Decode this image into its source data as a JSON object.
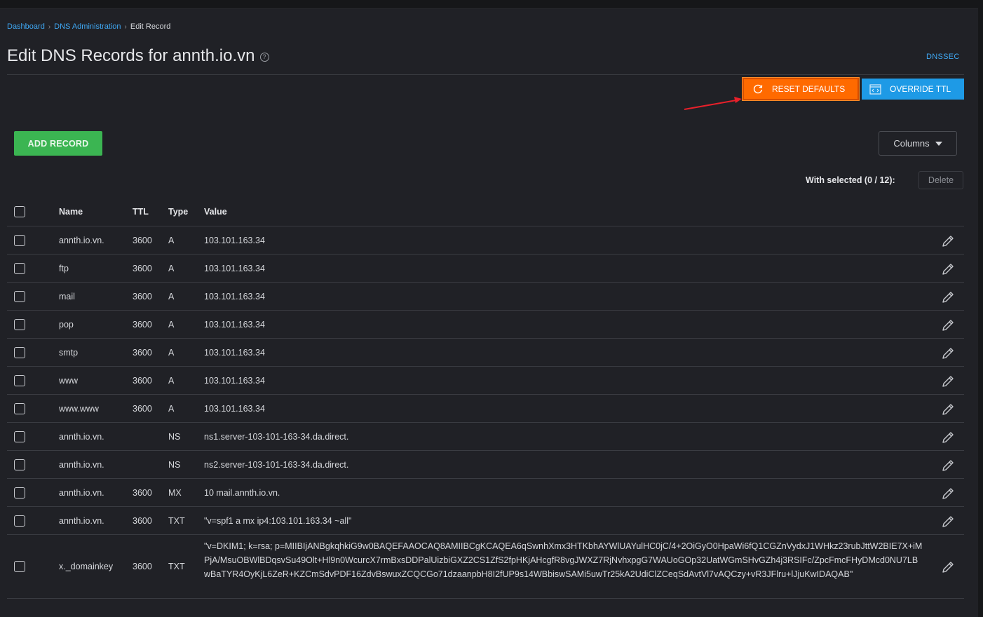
{
  "breadcrumb": {
    "items": [
      "Dashboard",
      "DNS Administration",
      "Edit Record"
    ]
  },
  "header": {
    "title": "Edit DNS Records for annth.io.vn",
    "dnssec_link": "DNSSEC"
  },
  "toolbar": {
    "reset_label": "RESET DEFAULTS",
    "override_label": "OVERRIDE TTL",
    "add_label": "ADD RECORD",
    "columns_label": "Columns",
    "with_selected_label": "With selected (0 / 12):",
    "delete_label": "Delete"
  },
  "colors": {
    "reset": "#ff6a00",
    "override": "#1e9ae6",
    "add": "#3bb552",
    "link": "#3fa9f5",
    "annotation_arrow": "#e8202a"
  },
  "table": {
    "headers": {
      "name": "Name",
      "ttl": "TTL",
      "type": "Type",
      "value": "Value"
    },
    "rows": [
      {
        "name": "annth.io.vn.",
        "ttl": "3600",
        "type": "A",
        "value": "103.101.163.34"
      },
      {
        "name": "ftp",
        "ttl": "3600",
        "type": "A",
        "value": "103.101.163.34"
      },
      {
        "name": "mail",
        "ttl": "3600",
        "type": "A",
        "value": "103.101.163.34"
      },
      {
        "name": "pop",
        "ttl": "3600",
        "type": "A",
        "value": "103.101.163.34"
      },
      {
        "name": "smtp",
        "ttl": "3600",
        "type": "A",
        "value": "103.101.163.34"
      },
      {
        "name": "www",
        "ttl": "3600",
        "type": "A",
        "value": "103.101.163.34"
      },
      {
        "name": "www.www",
        "ttl": "3600",
        "type": "A",
        "value": "103.101.163.34"
      },
      {
        "name": "annth.io.vn.",
        "ttl": "",
        "type": "NS",
        "value": "ns1.server-103-101-163-34.da.direct."
      },
      {
        "name": "annth.io.vn.",
        "ttl": "",
        "type": "NS",
        "value": "ns2.server-103-101-163-34.da.direct."
      },
      {
        "name": "annth.io.vn.",
        "ttl": "3600",
        "type": "MX",
        "value": "10 mail.annth.io.vn."
      },
      {
        "name": "annth.io.vn.",
        "ttl": "3600",
        "type": "TXT",
        "value": "\"v=spf1 a mx ip4:103.101.163.34 ~all\""
      },
      {
        "name": "x._domainkey",
        "ttl": "3600",
        "type": "TXT",
        "value": "\"v=DKIM1; k=rsa; p=MIIBIjANBgkqhkiG9w0BAQEFAAOCAQ8AMIIBCgKCAQEA6qSwnhXmx3HTKbhAYWlUAYulHC0jC/4+2OiGyO0HpaWi6fQ1CGZnVydxJ1WHkz23rubJttW2BIE7X+iMPjA/MsuOBWlBDqsvSu49Olt+Hl9n0WcurcX7rmBxsDDPalUizbiGXZ2CS1ZfS2fpHKjAHcgfR8vgJWXZ7RjNvhxpgG7WAUoGOp32UatWGmSHvGZh4j3RSIFc/ZpcFmcFHyDMcd0NU7LBwBaTYR4OyKjL6ZeR+KZCmSdvPDF16ZdvBswuxZCQCGo71dzaanpbH8I2fUP9s14WBbiswSAMi5uwTr25kA2UdiClZCeqSdAvtVl7vAQCzy+vR3JFlru+lJjuKwIDAQAB\""
      }
    ]
  }
}
